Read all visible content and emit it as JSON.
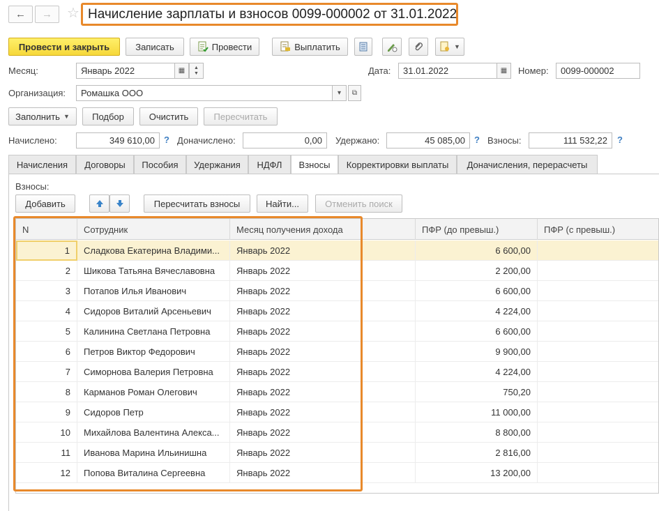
{
  "window": {
    "title": "Начисление зарплаты и взносов 0099-000002 от 31.01.2022",
    "back_icon": "←",
    "forward_icon": "→",
    "star_icon": "☆"
  },
  "toolbar": {
    "post_close": "Провести и закрыть",
    "save": "Записать",
    "post": "Провести",
    "pay": "Выплатить"
  },
  "form": {
    "month_label": "Месяц:",
    "month_value": "Январь 2022",
    "date_label": "Дата:",
    "date_value": "31.01.2022",
    "number_label": "Номер:",
    "number_value": "0099-000002",
    "org_label": "Организация:",
    "org_value": "Ромашка ООО"
  },
  "actions": {
    "fill": "Заполнить",
    "select": "Подбор",
    "clear": "Очистить",
    "recalc": "Пересчитать"
  },
  "totals": {
    "accrued_label": "Начислено:",
    "accrued_value": "349 610,00",
    "additional_label": "Доначислено:",
    "additional_value": "0,00",
    "withheld_label": "Удержано:",
    "withheld_value": "45 085,00",
    "contrib_label": "Взносы:",
    "contrib_value": "111 532,22",
    "help": "?"
  },
  "tabs": [
    {
      "label": "Начисления"
    },
    {
      "label": "Договоры"
    },
    {
      "label": "Пособия"
    },
    {
      "label": "Удержания"
    },
    {
      "label": "НДФЛ"
    },
    {
      "label": "Взносы"
    },
    {
      "label": "Корректировки выплаты"
    },
    {
      "label": "Доначисления, перерасчеты"
    }
  ],
  "contributions": {
    "section_label": "Взносы:",
    "add": "Добавить",
    "recalc": "Пересчитать взносы",
    "find": "Найти...",
    "cancel_search": "Отменить поиск",
    "columns": [
      "N",
      "Сотрудник",
      "Месяц получения дохода",
      "ПФР (до превыш.)",
      "ПФР (с превыш.)"
    ],
    "rows": [
      {
        "n": "1",
        "employee": "Сладкова Екатерина Владими...",
        "month": "Январь 2022",
        "pfr": "6 600,00",
        "pfr_over": ""
      },
      {
        "n": "2",
        "employee": "Шикова Татьяна Вячеславовна",
        "month": "Январь 2022",
        "pfr": "2 200,00",
        "pfr_over": ""
      },
      {
        "n": "3",
        "employee": "Потапов Илья Иванович",
        "month": "Январь 2022",
        "pfr": "6 600,00",
        "pfr_over": ""
      },
      {
        "n": "4",
        "employee": "Сидоров Виталий Арсеньевич",
        "month": "Январь 2022",
        "pfr": "4 224,00",
        "pfr_over": ""
      },
      {
        "n": "5",
        "employee": "Калинина Светлана Петровна",
        "month": "Январь 2022",
        "pfr": "6 600,00",
        "pfr_over": ""
      },
      {
        "n": "6",
        "employee": "Петров Виктор Федорович",
        "month": "Январь 2022",
        "pfr": "9 900,00",
        "pfr_over": ""
      },
      {
        "n": "7",
        "employee": "Симорнова Валерия Петровна",
        "month": "Январь 2022",
        "pfr": "4 224,00",
        "pfr_over": ""
      },
      {
        "n": "8",
        "employee": "Карманов Роман Олегович",
        "month": "Январь 2022",
        "pfr": "750,20",
        "pfr_over": ""
      },
      {
        "n": "9",
        "employee": "Сидоров Петр",
        "month": "Январь 2022",
        "pfr": "11 000,00",
        "pfr_over": ""
      },
      {
        "n": "10",
        "employee": "Михайлова Валентина Алекса...",
        "month": "Январь 2022",
        "pfr": "8 800,00",
        "pfr_over": ""
      },
      {
        "n": "11",
        "employee": "Иванова Марина Ильинишна",
        "month": "Январь 2022",
        "pfr": "2 816,00",
        "pfr_over": ""
      },
      {
        "n": "12",
        "employee": "Попова Виталина Сергеевна",
        "month": "Январь 2022",
        "pfr": "13 200,00",
        "pfr_over": ""
      }
    ]
  },
  "colors": {
    "highlight": "#e8892b",
    "primary_button": "#f6d83a",
    "selected_row": "#fbf2d2",
    "help": "#3f7fc2"
  }
}
